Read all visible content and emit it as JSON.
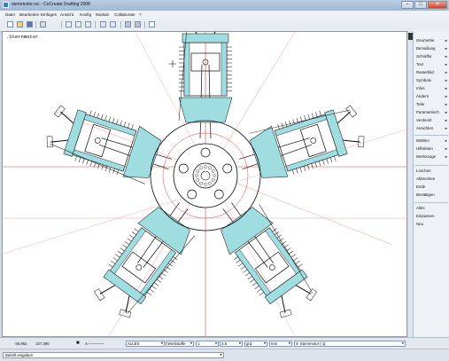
{
  "window": {
    "title": "sternmotor.rvc - CoCreate Drafting 2008",
    "minimize_glyph": "–",
    "maximize_glyph": "□",
    "close_glyph": "✕"
  },
  "menu": [
    "Datei",
    "Bearbeiten",
    "Einfügen",
    "Ansicht",
    "Konfig",
    "Module",
    "Collaborate",
    "?"
  ],
  "toolbar_icons": [
    "new-icon",
    "open-icon",
    "save-icon",
    "print-icon",
    "cut-icon",
    "copy-icon",
    "paste-icon",
    "undo-icon",
    "redo-icon",
    "layout-icon",
    "grid-icon",
    "zoom-icon"
  ],
  "drawing": {
    "title": ".Sternmotor"
  },
  "right_panel": {
    "group1": [
      {
        "label": "Geometrie",
        "arrow": "▸"
      },
      {
        "label": "Bemaßung",
        "arrow": "▸"
      },
      {
        "label": "Schraffur",
        "arrow": "▸"
      },
      {
        "label": "Text",
        "arrow": "▸"
      },
      {
        "label": "Rasterbild",
        "arrow": "▸"
      },
      {
        "label": "Symbole",
        "arrow": "▸"
      },
      {
        "label": "Infos",
        "arrow": "▸"
      },
      {
        "label": "Ändern",
        "arrow": "▸"
      },
      {
        "label": "Teile",
        "arrow": "▸"
      },
      {
        "label": "Parametrisch",
        "arrow": "▸"
      },
      {
        "label": "Verdeckt",
        "arrow": "▸"
      },
      {
        "label": "Ansichten",
        "arrow": "▸"
      }
    ],
    "group2": [
      {
        "label": "Wählen",
        "arrow": "▸"
      },
      {
        "label": "Hilfslinien",
        "arrow": "▸"
      },
      {
        "label": "Werkzeuge",
        "arrow": "▸"
      }
    ],
    "group3": [
      {
        "label": "Löschen",
        "arrow": ""
      },
      {
        "label": "Abbrechen",
        "arrow": ""
      },
      {
        "label": "Ende",
        "arrow": ""
      },
      {
        "label": "Bestätigen",
        "arrow": ""
      }
    ],
    "group4": [
      {
        "label": "Alles",
        "arrow": ""
      },
      {
        "label": "Einpassen",
        "arrow": ""
      },
      {
        "label": "Neu",
        "arrow": ""
      }
    ]
  },
  "statusbar": {
    "x": "-35.952",
    "y": "107.390",
    "color_label": "■",
    "linestyle_label": "Λ ————",
    "filter": "ALLES",
    "pen": "Werkstoffe",
    "scale": "1",
    "size": "3.5",
    "unit_angle": "grd",
    "unit_length": "mm",
    "part": "0: Sternmotor [-1]"
  },
  "command": {
    "prompt": "Befehl eingeben"
  },
  "colors": {
    "geometry": "#0a0a0a",
    "hatch_fill": "#9fdde0",
    "construction_red": "#e04040",
    "construction_pink": "#ee9999"
  }
}
